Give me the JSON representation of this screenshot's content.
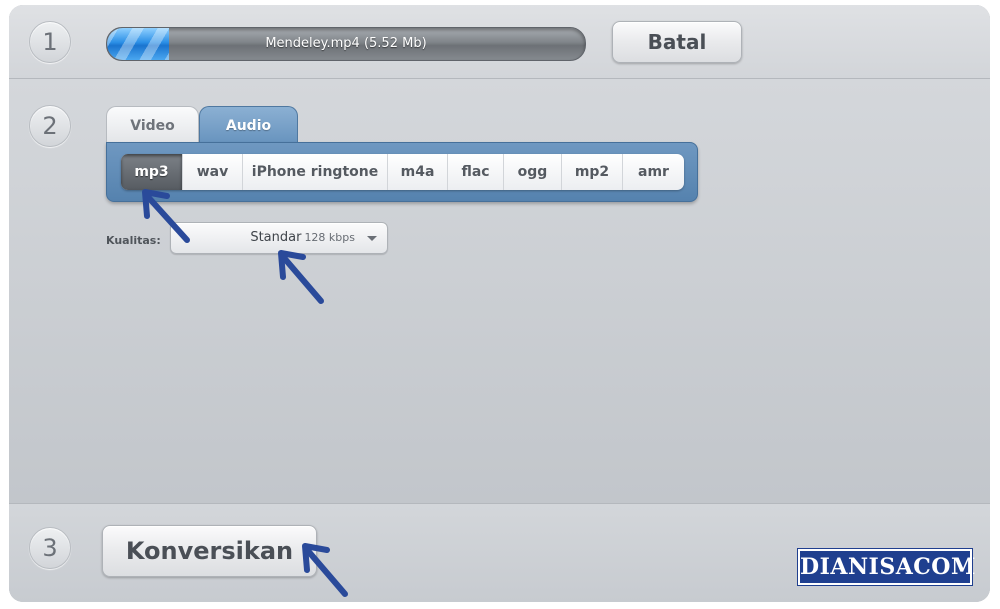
{
  "steps": {
    "step1": "1",
    "step2": "2",
    "step3": "3"
  },
  "upload": {
    "file_label": "Mendeley.mp4 (5.52 Mb)",
    "progress_fraction": 0.13,
    "progress_color": "#2b8fe6"
  },
  "cancel_button": {
    "label": "Batal"
  },
  "tabs": [
    {
      "label": "Video",
      "selected": false
    },
    {
      "label": "Audio",
      "selected": true
    }
  ],
  "formats": [
    {
      "label": "mp3",
      "selected": true
    },
    {
      "label": "wav",
      "selected": false
    },
    {
      "label": "iPhone ringtone",
      "selected": false
    },
    {
      "label": "m4a",
      "selected": false
    },
    {
      "label": "flac",
      "selected": false
    },
    {
      "label": "ogg",
      "selected": false
    },
    {
      "label": "mp2",
      "selected": false
    },
    {
      "label": "amr",
      "selected": false
    }
  ],
  "quality": {
    "label": "Kualitas:",
    "value": "Standar",
    "bitrate": "128 kbps"
  },
  "convert_button": {
    "label": "Konversikan"
  },
  "watermark": {
    "text": "DIANISACOM",
    "color": "#1f3f8f"
  },
  "colors": {
    "tab_active": "#6692bd",
    "annotation_arrow": "#2a4a9a"
  },
  "icons": {
    "dropdown": "chevron-down-icon",
    "annotation": "arrow-pointer-icon"
  }
}
